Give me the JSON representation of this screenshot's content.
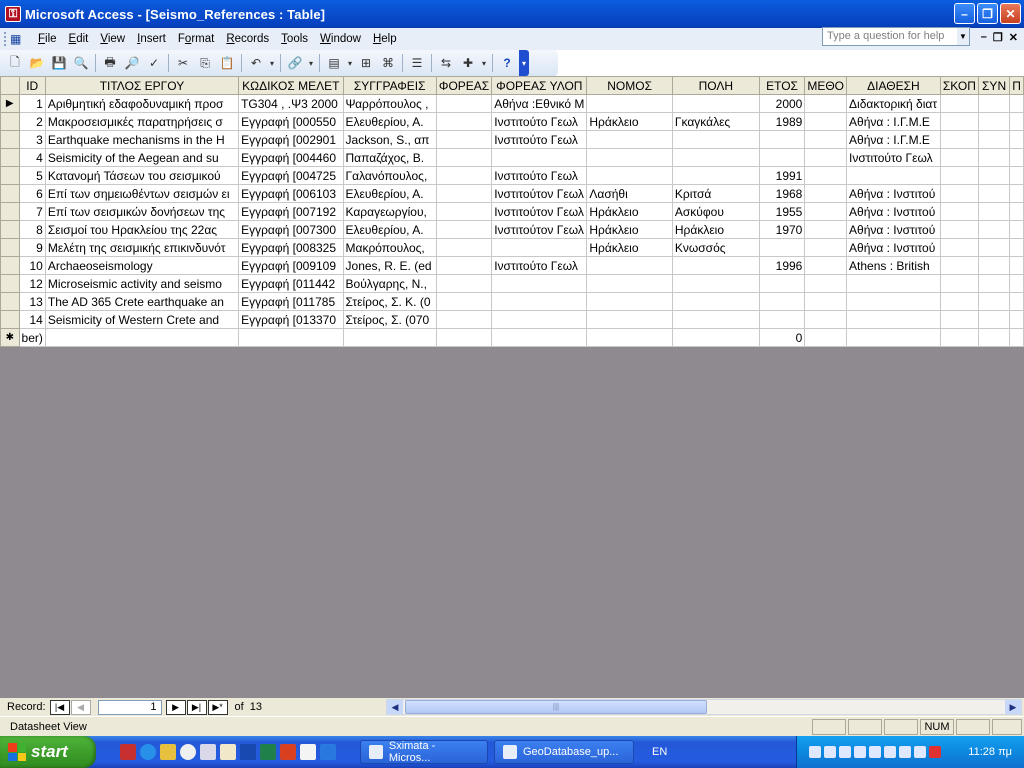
{
  "window": {
    "title": "Microsoft Access - [Seismo_References : Table]",
    "app_icon": "access-key-icon"
  },
  "menu": {
    "items": [
      {
        "label": "File",
        "u": "F",
        "rest": "ile"
      },
      {
        "label": "Edit",
        "u": "E",
        "rest": "dit"
      },
      {
        "label": "View",
        "u": "V",
        "rest": "iew"
      },
      {
        "label": "Insert",
        "u": "I",
        "rest": "nsert"
      },
      {
        "label": "Format",
        "pre": "F",
        "u": "o",
        "rest": "rmat"
      },
      {
        "label": "Records",
        "u": "R",
        "rest": "ecords"
      },
      {
        "label": "Tools",
        "u": "T",
        "rest": "ools"
      },
      {
        "label": "Window",
        "u": "W",
        "rest": "indow"
      },
      {
        "label": "Help",
        "u": "H",
        "rest": "elp"
      }
    ],
    "help_placeholder": "Type a question for help"
  },
  "table": {
    "columns": [
      "ID",
      "ΤΙΤΛΟΣ ΕΡΓΟΥ",
      "ΚΩΔΙΚΟΣ ΜΕΛΕΤ",
      "ΣΥΓΓΡΑΦΕΙΣ",
      "ΦΟΡΕΑΣ",
      "ΦΟΡΕΑΣ ΥΛΟΠ",
      "ΝΟΜΟΣ",
      "ΠΟΛΗ",
      "ΕΤΟΣ",
      "ΜΕΘΟ",
      "ΔΙΑΘΕΣΗ",
      "ΣΚΟΠ",
      "ΣΥΝ",
      "Π"
    ],
    "rows": [
      [
        "1",
        "Αριθμητική εδαφοδυναμική προσ",
        "TG304 , .Ψ3 2000",
        "Ψαρρόπουλος ,",
        "",
        "Αθήνα :Εθνικό Μ",
        "",
        "",
        "2000",
        "",
        "Διδακτορική διατ",
        "",
        "",
        ""
      ],
      [
        "2",
        "Μακροσεισμικές παρατηρήσεις σ",
        "Εγγραφή [000550",
        "Ελευθερίου, Α.",
        "",
        "Ινστιτούτο Γεωλ",
        "Ηράκλειο",
        "Γκαγκάλες",
        "1989",
        "",
        "Αθήνα : Ι.Γ.Μ.Ε",
        "",
        "",
        ""
      ],
      [
        "3",
        "Earthquake mechanisms in the H",
        "Εγγραφή [002901",
        "Jackson, S., απ",
        "",
        "Ινστιτούτο Γεωλ",
        "",
        "",
        "",
        "",
        "Αθήνα : Ι.Γ.Μ.Ε",
        "",
        "",
        ""
      ],
      [
        "4",
        "Seismicity of the Aegean and su",
        "Εγγραφή [004460",
        "Παπαζάχος, Β.",
        "",
        "",
        "",
        "",
        "",
        "",
        "Ινστιτούτο Γεωλ",
        "",
        "",
        ""
      ],
      [
        "5",
        "Κατανομή Τάσεων του σεισμικού",
        "Εγγραφή [004725",
        "Γαλανόπουλος,",
        "",
        "Ινστιτούτο Γεωλ",
        "",
        "",
        "1991",
        "",
        "",
        "",
        "",
        ""
      ],
      [
        "6",
        "Επί των σημειωθέντων σεισμών ει",
        "Εγγραφή [006103",
        "Ελευθερίου, Α.",
        "",
        "Ινστιτούτον Γεωλ",
        "Λασήθι",
        "Κριτσά",
        "1968",
        "",
        "Αθήνα : Ινστιτού",
        "",
        "",
        ""
      ],
      [
        "7",
        "Επί των σεισμικών δονήσεων της",
        "Εγγραφή [007192",
        "Καραγεωργίου,",
        "",
        "Ινστιτούτον Γεωλ",
        "Ηράκλειο",
        "Ασκύφου",
        "1955",
        "",
        "Αθήνα : Ινστιτού",
        "",
        "",
        ""
      ],
      [
        "8",
        "Σεισμοί του Ηρακλείου της 22ας",
        "Εγγραφή [007300",
        "Ελευθερίου, Α.",
        "",
        "Ινστιτούτον Γεωλ",
        "Ηράκλειο",
        "Ηράκλειο",
        "1970",
        "",
        "Αθήνα : Ινστιτού",
        "",
        "",
        ""
      ],
      [
        "9",
        "Μελέτη της σεισμικής επικινδυνότ",
        "Εγγραφή [008325",
        "Μακρόπουλος,",
        "",
        "",
        "Ηράκλειο",
        "Κνωσσός",
        "",
        "",
        "Αθήνα : Ινστιτού",
        "",
        "",
        ""
      ],
      [
        "10",
        "Archaeoseismology",
        "Εγγραφή [009109",
        "Jones, R. E. (ed",
        "",
        "Ινστιτούτο Γεωλ",
        "",
        "",
        "1996",
        "",
        "Athens : British",
        "",
        "",
        ""
      ],
      [
        "12",
        "Microseismic activity and seismo",
        "Εγγραφή [011442",
        "Βούλγαρης, Ν.,",
        "",
        "",
        "",
        "",
        "",
        "",
        "",
        "",
        "",
        ""
      ],
      [
        "13",
        "The AD 365 Crete earthquake an",
        "Εγγραφή [011785",
        "Στείρος, Σ. Κ. (0",
        "",
        "",
        "",
        "",
        "",
        "",
        "",
        "",
        "",
        ""
      ],
      [
        "14",
        "Seismicity of Western Crete and",
        "Εγγραφή [013370",
        "Στείρος, Σ. (070",
        "",
        "",
        "",
        "",
        "",
        "",
        "",
        "",
        "",
        ""
      ]
    ],
    "new_row_id": "ber)",
    "new_row_year": "0"
  },
  "nav": {
    "label": "Record:",
    "current": "1",
    "of": "of",
    "total": "13"
  },
  "status": {
    "view": "Datasheet View",
    "num": "NUM"
  },
  "taskbar": {
    "start": "start",
    "tasks": [
      "Sximata - Micros...",
      "GeoDatabase_up..."
    ],
    "lang": "EN",
    "clock": "11:28 πμ"
  }
}
